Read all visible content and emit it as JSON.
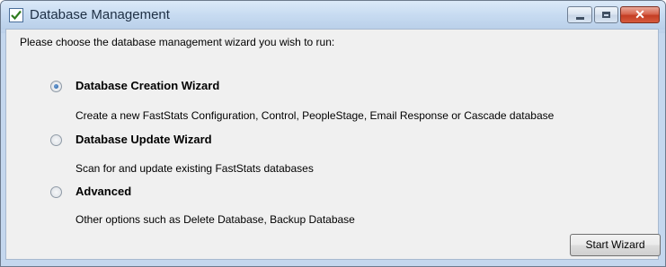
{
  "window": {
    "title": "Database Management",
    "icon": "checkmark-app-icon",
    "controls": {
      "minimize": "minimize-icon",
      "maximize": "maximize-icon",
      "close": "close-icon",
      "close_glyph": "✕"
    }
  },
  "prompt": "Please choose the database management wizard you wish to run:",
  "options": [
    {
      "label": "Database Creation Wizard",
      "description": "Create a new FastStats Configuration, Control, PeopleStage, Email Response or Cascade database",
      "selected": true
    },
    {
      "label": "Database Update Wizard",
      "description": "Scan for and update existing FastStats databases",
      "selected": false
    },
    {
      "label": "Advanced",
      "description": "Other options such as Delete Database, Backup Database",
      "selected": false
    }
  ],
  "actions": {
    "start_label": "Start Wizard"
  },
  "colors": {
    "title_text": "#1e2f44",
    "close_button": "#c43d24",
    "radio_selected": "#225ba0"
  }
}
